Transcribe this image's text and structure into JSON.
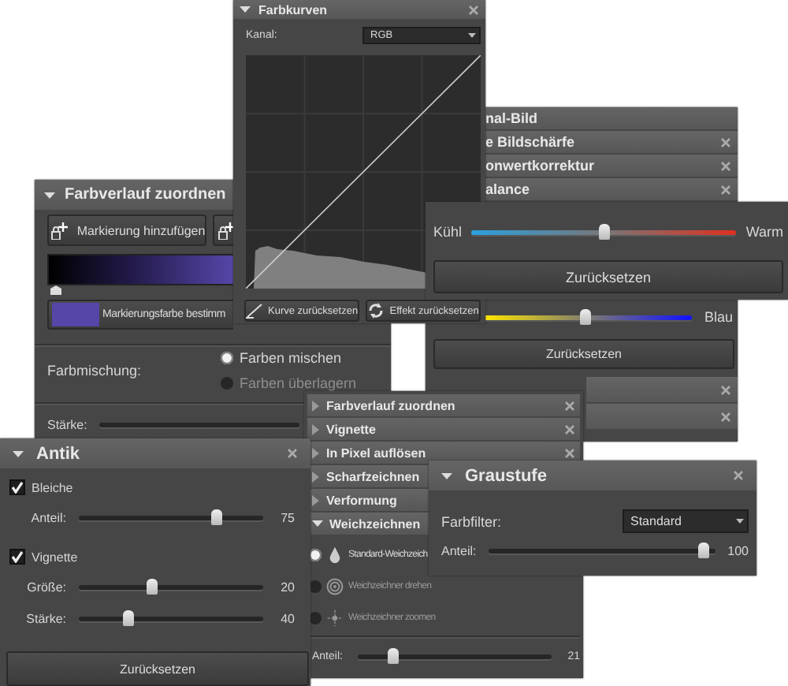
{
  "farbbalance_panel": {
    "headers": [
      {
        "title": "nal-Bild",
        "closable": false
      },
      {
        "title": "e Bildschärfe",
        "closable": true
      },
      {
        "title": "onwertkorrektur",
        "closable": true
      },
      {
        "title": "alance",
        "closable": true
      }
    ],
    "slider": {
      "right_label": "Blau",
      "level": 0.49
    },
    "reset_button": "Zurücksetzen",
    "footer_headers": [
      {
        "closable": true
      },
      {
        "closable": true
      }
    ]
  },
  "farbverlauf_panel": {
    "title": "Farbverlauf zuordnen",
    "expanded": true,
    "add_button": "Markierung hinzufügen",
    "color_button": "Markierungsfarbe bestimm",
    "mix_label": "Farbmischung:",
    "mix_options": [
      {
        "label": "Farben mischen",
        "selected": true
      },
      {
        "label": "Farben überlagern",
        "selected": false
      }
    ],
    "strength_label": "Stärke:"
  },
  "farbkurven_panel": {
    "title": "Farbkurven",
    "expanded": true,
    "channel_label": "Kanal:",
    "channel_value": "RGB",
    "buttons": [
      {
        "label": "Kurve zurücksetzen",
        "kind": "curve"
      },
      {
        "label": "Effekt zurücksetzen",
        "kind": "refresh"
      }
    ]
  },
  "temperature_panel": {
    "left_label": "Kühl",
    "right_label": "Warm",
    "level": 0.5,
    "reset_button": "Zurücksetzen"
  },
  "effects_list": {
    "items": [
      {
        "title": "Farbverlauf zuordnen",
        "expanded": false,
        "closable": true
      },
      {
        "title": "Vignette",
        "expanded": false,
        "closable": true
      },
      {
        "title": "In Pixel auflösen",
        "expanded": false,
        "closable": true
      },
      {
        "title": "Scharfzeichnen",
        "expanded": false,
        "closable": false
      },
      {
        "title": "Verformung",
        "expanded": false,
        "closable": false
      },
      {
        "title": "Weichzeichnen",
        "expanded": true,
        "closable": false
      }
    ],
    "blur_options": [
      {
        "label": "Standard-Weichzeich",
        "kind": "drop",
        "selected": true
      },
      {
        "label": "Weichzeichner drehen",
        "kind": "swirl",
        "selected": false
      },
      {
        "label": "Weichzeichner zoomen",
        "kind": "zoom",
        "selected": false
      }
    ],
    "amount": {
      "label": "Anteil:",
      "level": 0.18,
      "value": "21"
    }
  },
  "graustufe_panel": {
    "title": "Graustufe",
    "expanded": true,
    "filter_label": "Farbfilter:",
    "filter_value": "Standard",
    "amount": {
      "label": "Anteil:",
      "level": 0.95,
      "value": "100"
    }
  },
  "antik_panel": {
    "title": "Antik",
    "expanded": true,
    "bleach": {
      "label": "Bleiche",
      "checked": true,
      "amount": {
        "label": "Anteil:",
        "level": 0.75,
        "value": "75"
      }
    },
    "vignette": {
      "label": "Vignette",
      "checked": true,
      "sliders": [
        {
          "label": "Größe:",
          "level": 0.4,
          "value": "20"
        },
        {
          "label": "Stärke:",
          "level": 0.27,
          "value": "40"
        }
      ]
    },
    "reset_button": "Zurücksetzen"
  }
}
